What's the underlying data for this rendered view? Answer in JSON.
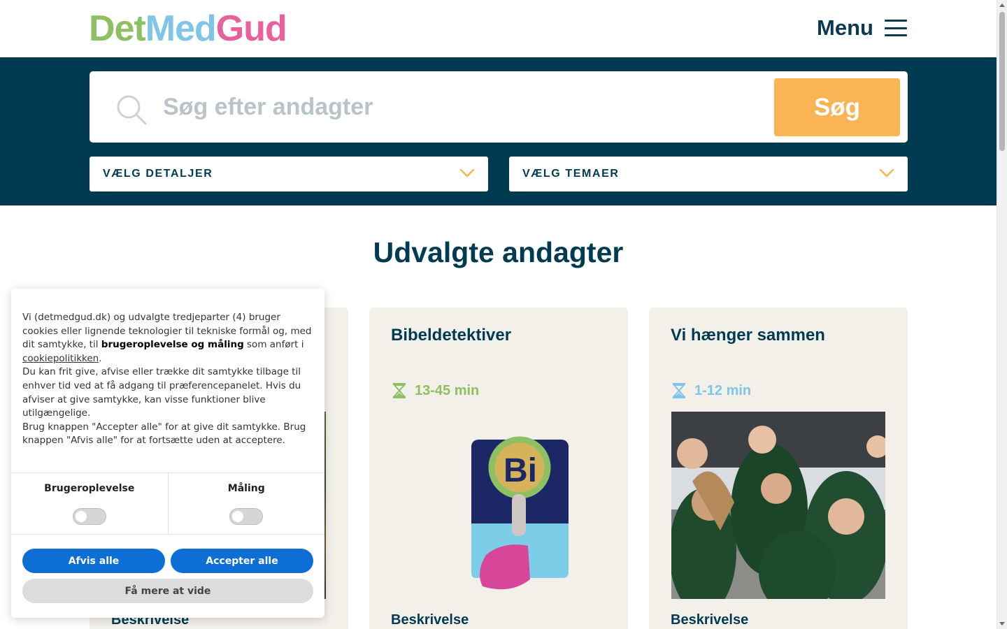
{
  "header": {
    "logo": {
      "part1": "Det",
      "part2": "Med",
      "part3": "Gud"
    },
    "menu_label": "Menu"
  },
  "search": {
    "placeholder": "Søg efter andagter",
    "button_label": "Søg",
    "select_details": "VÆLG DETALJER",
    "select_themes": "VÆLG TEMAER"
  },
  "main": {
    "title": "Udvalgte andagter",
    "cards": [
      {
        "title": "",
        "time": "",
        "desc_label": "Beskrivelse"
      },
      {
        "title": "Bibeldetektiver",
        "time": "13-45 min",
        "desc_label": "Beskrivelse",
        "time_color": "#8cc063"
      },
      {
        "title": "Vi hænger sammen",
        "time": "1-12 min",
        "desc_label": "Beskrivelse",
        "time_color": "#7ec5e8"
      }
    ]
  },
  "cookie": {
    "text_1": "Vi (detmedgud.dk) og udvalgte tredjeparter (4) bruger cookies eller lignende teknologier til tekniske formål og, med dit samtykke, til ",
    "text_bold": "brugeroplevelse og måling",
    "text_2": " som anført i ",
    "text_link": "cookiepolitikken",
    "text_3": ".",
    "text_para2": "Du kan frit give, afvise eller trække dit samtykke tilbage til enhver tid ved at få adgang til præferencepanelet. Hvis du afviser at give samtykke, kan visse funktioner blive utilgængelige.",
    "text_para3": "Brug knappen \"Accepter alle\" for at give dit samtykke. Brug knappen \"Afvis alle\" for at fortsætte uden at acceptere.",
    "toggle_experience": "Brugeroplevelse",
    "toggle_measurement": "Måling",
    "deny_label": "Afvis alle",
    "accept_label": "Accepter alle",
    "more_label": "Få mere at vide"
  },
  "colors": {
    "navy": "#003b52",
    "orange": "#fbb454",
    "green": "#8cc063",
    "blue": "#7ec5e8",
    "pink": "#e8609c",
    "card_bg": "#f3f0ea",
    "cookie_button": "#0d6ed6"
  },
  "icons": {
    "search": "magnifier-icon",
    "chevron": "chevron-down-icon",
    "hourglass": "hourglass-icon",
    "menu": "hamburger-icon"
  }
}
